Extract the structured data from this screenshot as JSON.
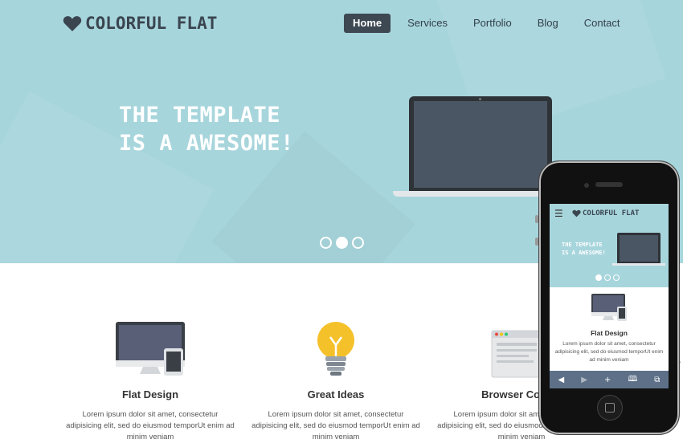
{
  "colors": {
    "hero_bg": "#a7d5dc",
    "nav_active_bg": "#3d4852",
    "logo_color": "#3a4550",
    "bulb_yellow": "#f5c12a"
  },
  "brand": {
    "name": "COLORFUL FLAT",
    "icon": "heart-icon"
  },
  "nav": {
    "items": [
      {
        "label": "Home",
        "active": true
      },
      {
        "label": "Services",
        "active": false
      },
      {
        "label": "Portfolio",
        "active": false
      },
      {
        "label": "Blog",
        "active": false
      },
      {
        "label": "Contact",
        "active": false
      }
    ]
  },
  "hero": {
    "title_line1": "THE TEMPLATE",
    "title_line2": "IS A AWESOME!",
    "slides": 3,
    "active_slide": 2
  },
  "features": [
    {
      "icon": "desktop-tablet-icon",
      "title": "Flat Design",
      "text": "Lorem ipsum dolor sit amet, consectetur adipisicing elit, sed do eiusmod temporUt enim ad minim veniam"
    },
    {
      "icon": "lightbulb-icon",
      "title": "Great Ideas",
      "text": "Lorem ipsum dolor sit amet, consectetur adipisicing elit, sed do eiusmod temporUt enim ad minim veniam"
    },
    {
      "icon": "browser-window-icon",
      "title": "Browser Compa",
      "text": "Lorem ipsum dolor sit amet, consectetur adipisicing elit, sed do eiusmod temporUt enim ad minim veniam"
    }
  ],
  "phone_preview": {
    "menu_icon": "☰",
    "brand": "COLORFUL FLAT",
    "title_line1": "THE TEMPLATE",
    "title_line2": "IS A AWESOME!",
    "feature_title": "Flat Design",
    "feature_text": "Lorem ipsum dolor sit amet, consectetur adipisicing elit, sed do eiusmod temporUt enim ad minim veniam",
    "toolbar": [
      "◀",
      "▶",
      "+",
      "🕮",
      "⧉"
    ]
  }
}
